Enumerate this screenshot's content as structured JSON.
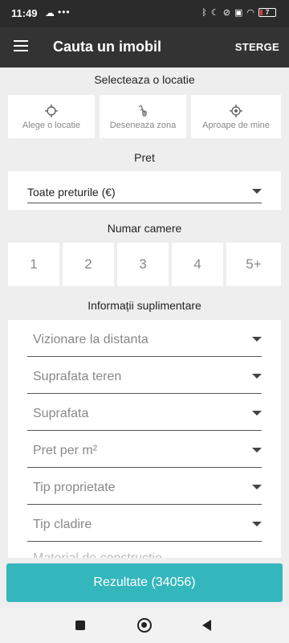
{
  "status": {
    "time": "11:49",
    "battery": "7"
  },
  "header": {
    "title": "Cauta un imobil",
    "action": "STERGE"
  },
  "location": {
    "title": "Selecteaza o locatie",
    "options": [
      {
        "label": "Alege o locatie",
        "icon": "crosshair-icon"
      },
      {
        "label": "Deseneaza zona",
        "icon": "draw-hand-icon"
      },
      {
        "label": "Aproape de mine",
        "icon": "my-location-icon"
      }
    ]
  },
  "price": {
    "title": "Pret",
    "value": "Toate preturile (€)"
  },
  "rooms": {
    "title": "Numar camere",
    "options": [
      "1",
      "2",
      "3",
      "4",
      "5+"
    ]
  },
  "extra": {
    "title": "Informații suplimentare",
    "fields": [
      "Vizionare la distanta",
      "Suprafata teren",
      "Suprafata",
      "Pret per m²",
      "Tip proprietate",
      "Tip cladire",
      "Material de constructie"
    ]
  },
  "results_button": "Rezultate (34056)",
  "colors": {
    "accent": "#34b6bd",
    "appbar": "#333333",
    "statusbar": "#2b2b2b"
  }
}
